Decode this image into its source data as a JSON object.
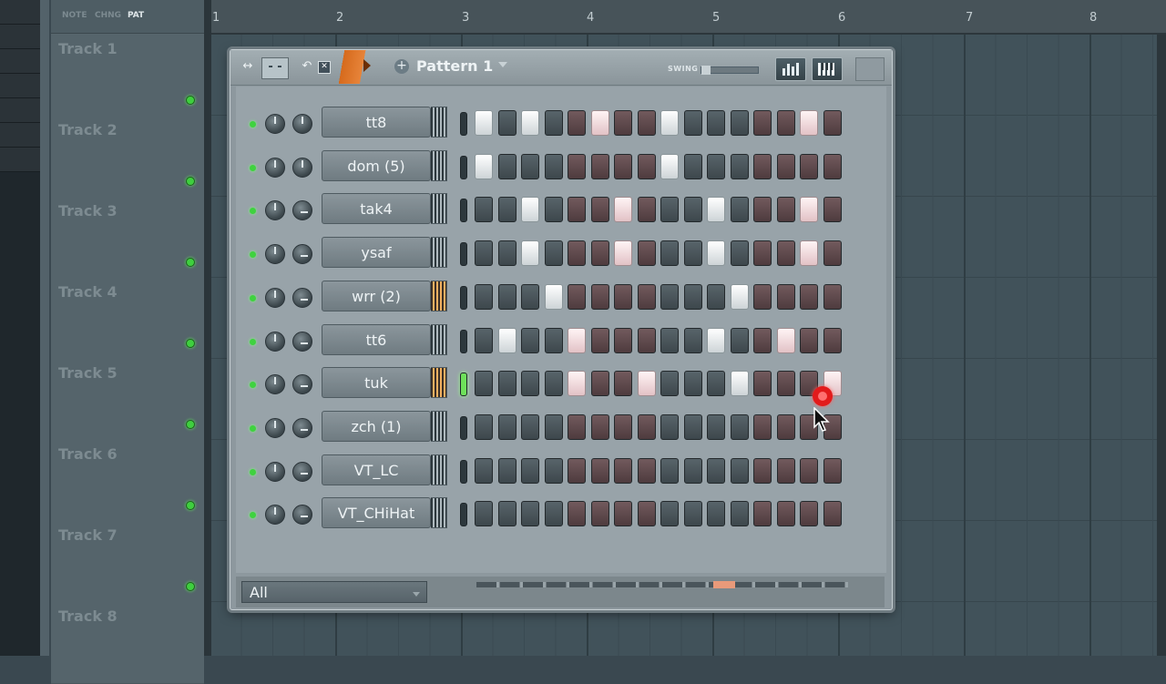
{
  "mode_tabs": [
    "NOTE",
    "CHNG",
    "PAT"
  ],
  "timeline": {
    "bar_numbers": [
      "1",
      "2",
      "3",
      "4",
      "5",
      "6",
      "7",
      "8"
    ]
  },
  "tracks": [
    "Track 1",
    "Track 2",
    "Track 3",
    "Track 4",
    "Track 5",
    "Track 6",
    "Track 7",
    "Track 8"
  ],
  "sequencer": {
    "pattern_name": "Pattern 1",
    "swing_label": "SWING",
    "filter_value": "All",
    "colors": {
      "accent": "#e7843a",
      "step_on": "#ffffff",
      "step_off_gray": "#4a555b",
      "step_off_red": "#5e4649",
      "led_green": "#3fd23f"
    },
    "channels": [
      {
        "name": "tt8",
        "steps": "1010010010000010",
        "selected": false
      },
      {
        "name": "dom (5)",
        "steps": "1000000010000000",
        "selected": false
      },
      {
        "name": "tak4",
        "steps": "0010001000100010",
        "selected": false
      },
      {
        "name": "ysaf",
        "steps": "0010001000100010",
        "selected": false
      },
      {
        "name": "wrr (2)",
        "steps": "0001000000010000",
        "selected": false
      },
      {
        "name": "tt6",
        "steps": "0100100000100100",
        "selected": false
      },
      {
        "name": "tuk",
        "steps": "0000100100010001",
        "selected": true
      },
      {
        "name": "zch (1)",
        "steps": "0000000000000000",
        "selected": false
      },
      {
        "name": "VT_LC",
        "steps": "0000000000000000",
        "selected": false
      },
      {
        "name": "VT_CHiHat",
        "steps": "0000000000000000",
        "selected": false
      }
    ],
    "current_step": 11
  }
}
